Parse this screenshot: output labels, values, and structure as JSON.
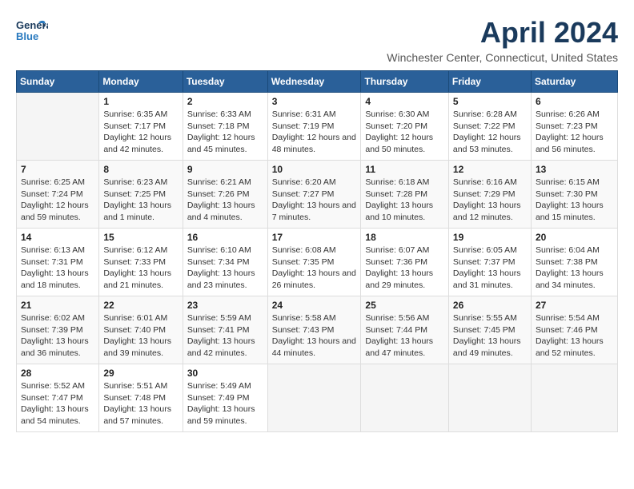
{
  "header": {
    "logo_line1": "General",
    "logo_line2": "Blue",
    "month": "April 2024",
    "location": "Winchester Center, Connecticut, United States"
  },
  "weekdays": [
    "Sunday",
    "Monday",
    "Tuesday",
    "Wednesday",
    "Thursday",
    "Friday",
    "Saturday"
  ],
  "weeks": [
    [
      {
        "day": "",
        "sunrise": "",
        "sunset": "",
        "daylight": ""
      },
      {
        "day": "1",
        "sunrise": "Sunrise: 6:35 AM",
        "sunset": "Sunset: 7:17 PM",
        "daylight": "Daylight: 12 hours and 42 minutes."
      },
      {
        "day": "2",
        "sunrise": "Sunrise: 6:33 AM",
        "sunset": "Sunset: 7:18 PM",
        "daylight": "Daylight: 12 hours and 45 minutes."
      },
      {
        "day": "3",
        "sunrise": "Sunrise: 6:31 AM",
        "sunset": "Sunset: 7:19 PM",
        "daylight": "Daylight: 12 hours and 48 minutes."
      },
      {
        "day": "4",
        "sunrise": "Sunrise: 6:30 AM",
        "sunset": "Sunset: 7:20 PM",
        "daylight": "Daylight: 12 hours and 50 minutes."
      },
      {
        "day": "5",
        "sunrise": "Sunrise: 6:28 AM",
        "sunset": "Sunset: 7:22 PM",
        "daylight": "Daylight: 12 hours and 53 minutes."
      },
      {
        "day": "6",
        "sunrise": "Sunrise: 6:26 AM",
        "sunset": "Sunset: 7:23 PM",
        "daylight": "Daylight: 12 hours and 56 minutes."
      }
    ],
    [
      {
        "day": "7",
        "sunrise": "Sunrise: 6:25 AM",
        "sunset": "Sunset: 7:24 PM",
        "daylight": "Daylight: 12 hours and 59 minutes."
      },
      {
        "day": "8",
        "sunrise": "Sunrise: 6:23 AM",
        "sunset": "Sunset: 7:25 PM",
        "daylight": "Daylight: 13 hours and 1 minute."
      },
      {
        "day": "9",
        "sunrise": "Sunrise: 6:21 AM",
        "sunset": "Sunset: 7:26 PM",
        "daylight": "Daylight: 13 hours and 4 minutes."
      },
      {
        "day": "10",
        "sunrise": "Sunrise: 6:20 AM",
        "sunset": "Sunset: 7:27 PM",
        "daylight": "Daylight: 13 hours and 7 minutes."
      },
      {
        "day": "11",
        "sunrise": "Sunrise: 6:18 AM",
        "sunset": "Sunset: 7:28 PM",
        "daylight": "Daylight: 13 hours and 10 minutes."
      },
      {
        "day": "12",
        "sunrise": "Sunrise: 6:16 AM",
        "sunset": "Sunset: 7:29 PM",
        "daylight": "Daylight: 13 hours and 12 minutes."
      },
      {
        "day": "13",
        "sunrise": "Sunrise: 6:15 AM",
        "sunset": "Sunset: 7:30 PM",
        "daylight": "Daylight: 13 hours and 15 minutes."
      }
    ],
    [
      {
        "day": "14",
        "sunrise": "Sunrise: 6:13 AM",
        "sunset": "Sunset: 7:31 PM",
        "daylight": "Daylight: 13 hours and 18 minutes."
      },
      {
        "day": "15",
        "sunrise": "Sunrise: 6:12 AM",
        "sunset": "Sunset: 7:33 PM",
        "daylight": "Daylight: 13 hours and 21 minutes."
      },
      {
        "day": "16",
        "sunrise": "Sunrise: 6:10 AM",
        "sunset": "Sunset: 7:34 PM",
        "daylight": "Daylight: 13 hours and 23 minutes."
      },
      {
        "day": "17",
        "sunrise": "Sunrise: 6:08 AM",
        "sunset": "Sunset: 7:35 PM",
        "daylight": "Daylight: 13 hours and 26 minutes."
      },
      {
        "day": "18",
        "sunrise": "Sunrise: 6:07 AM",
        "sunset": "Sunset: 7:36 PM",
        "daylight": "Daylight: 13 hours and 29 minutes."
      },
      {
        "day": "19",
        "sunrise": "Sunrise: 6:05 AM",
        "sunset": "Sunset: 7:37 PM",
        "daylight": "Daylight: 13 hours and 31 minutes."
      },
      {
        "day": "20",
        "sunrise": "Sunrise: 6:04 AM",
        "sunset": "Sunset: 7:38 PM",
        "daylight": "Daylight: 13 hours and 34 minutes."
      }
    ],
    [
      {
        "day": "21",
        "sunrise": "Sunrise: 6:02 AM",
        "sunset": "Sunset: 7:39 PM",
        "daylight": "Daylight: 13 hours and 36 minutes."
      },
      {
        "day": "22",
        "sunrise": "Sunrise: 6:01 AM",
        "sunset": "Sunset: 7:40 PM",
        "daylight": "Daylight: 13 hours and 39 minutes."
      },
      {
        "day": "23",
        "sunrise": "Sunrise: 5:59 AM",
        "sunset": "Sunset: 7:41 PM",
        "daylight": "Daylight: 13 hours and 42 minutes."
      },
      {
        "day": "24",
        "sunrise": "Sunrise: 5:58 AM",
        "sunset": "Sunset: 7:43 PM",
        "daylight": "Daylight: 13 hours and 44 minutes."
      },
      {
        "day": "25",
        "sunrise": "Sunrise: 5:56 AM",
        "sunset": "Sunset: 7:44 PM",
        "daylight": "Daylight: 13 hours and 47 minutes."
      },
      {
        "day": "26",
        "sunrise": "Sunrise: 5:55 AM",
        "sunset": "Sunset: 7:45 PM",
        "daylight": "Daylight: 13 hours and 49 minutes."
      },
      {
        "day": "27",
        "sunrise": "Sunrise: 5:54 AM",
        "sunset": "Sunset: 7:46 PM",
        "daylight": "Daylight: 13 hours and 52 minutes."
      }
    ],
    [
      {
        "day": "28",
        "sunrise": "Sunrise: 5:52 AM",
        "sunset": "Sunset: 7:47 PM",
        "daylight": "Daylight: 13 hours and 54 minutes."
      },
      {
        "day": "29",
        "sunrise": "Sunrise: 5:51 AM",
        "sunset": "Sunset: 7:48 PM",
        "daylight": "Daylight: 13 hours and 57 minutes."
      },
      {
        "day": "30",
        "sunrise": "Sunrise: 5:49 AM",
        "sunset": "Sunset: 7:49 PM",
        "daylight": "Daylight: 13 hours and 59 minutes."
      },
      {
        "day": "",
        "sunrise": "",
        "sunset": "",
        "daylight": ""
      },
      {
        "day": "",
        "sunrise": "",
        "sunset": "",
        "daylight": ""
      },
      {
        "day": "",
        "sunrise": "",
        "sunset": "",
        "daylight": ""
      },
      {
        "day": "",
        "sunrise": "",
        "sunset": "",
        "daylight": ""
      }
    ]
  ]
}
